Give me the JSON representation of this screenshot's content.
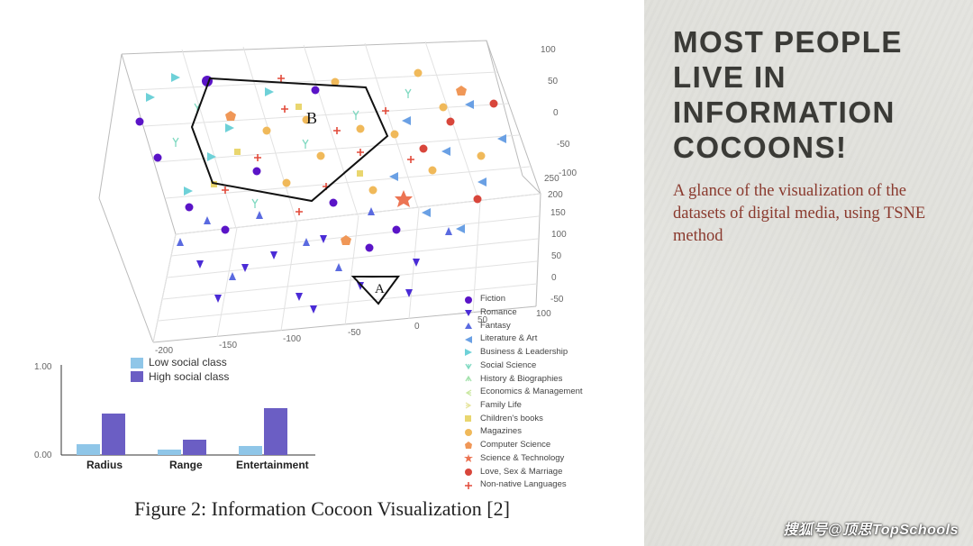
{
  "sidebar": {
    "title": "MOST PEOPLE LIVE IN INFORMATION COCOONS!",
    "subtitle": "A glance of the visualization of the datasets of digital media, using TSNE method"
  },
  "figure_caption": "Figure 2: Information Cocoon Visualization [2]",
  "watermark": "搜狐号@顶思TopSchools",
  "chart_data": [
    {
      "type": "scatter",
      "projection": "3d",
      "title": "",
      "xlabel": "",
      "ylabel": "",
      "zlabel": "",
      "xlim": [
        -200,
        200
      ],
      "ylim": [
        -100,
        100
      ],
      "zlim": [
        -100,
        100
      ],
      "xticks": [
        -200,
        -150,
        -100,
        -50,
        0,
        50,
        100
      ],
      "yticks": [
        -50,
        0,
        50,
        100,
        150,
        200,
        250
      ],
      "zticks": [
        -100,
        -50,
        0,
        50,
        100
      ],
      "annotations": [
        "A",
        "B"
      ],
      "legend": [
        {
          "label": "Fiction",
          "marker": "circle",
          "color": "#5a14c7"
        },
        {
          "label": "Romance",
          "marker": "triangle-down",
          "color": "#4a2bd6"
        },
        {
          "label": "Fantasy",
          "marker": "triangle-up",
          "color": "#5a6ae0"
        },
        {
          "label": "Literature & Art",
          "marker": "triangle-left",
          "color": "#6aa0e4"
        },
        {
          "label": "Business & Leadership",
          "marker": "triangle-right",
          "color": "#6ed1d8"
        },
        {
          "label": "Social Science",
          "marker": "tri-down",
          "color": "#7fd9c1"
        },
        {
          "label": "History & Biographies",
          "marker": "tri-up",
          "color": "#a3e2ab"
        },
        {
          "label": "Economics & Management",
          "marker": "tri-left",
          "color": "#c9e8a0"
        },
        {
          "label": "Family Life",
          "marker": "tri-right",
          "color": "#e6e49c"
        },
        {
          "label": "Children's books",
          "marker": "square",
          "color": "#e9d66f"
        },
        {
          "label": "Magazines",
          "marker": "circle",
          "color": "#f0b95a"
        },
        {
          "label": "Computer Science",
          "marker": "pentagon",
          "color": "#f09757"
        },
        {
          "label": "Science & Technology",
          "marker": "star",
          "color": "#ec7453"
        },
        {
          "label": "Love, Sex & Marriage",
          "marker": "circle",
          "color": "#d8463b"
        },
        {
          "label": "Non-native Languages",
          "marker": "plus",
          "color": "#e24a3a"
        }
      ],
      "note": "Approx. 175 points distributed roughly evenly across the 15 categories within a t-SNE cube; two polygon regions drawn and labeled A (small) and B (large).",
      "series_counts": {
        "Fiction": 12,
        "Romance": 12,
        "Fantasy": 12,
        "Literature & Art": 12,
        "Business & Leadership": 12,
        "Social Science": 12,
        "History & Biographies": 12,
        "Economics & Management": 12,
        "Family Life": 12,
        "Children's books": 11,
        "Magazines": 12,
        "Computer Science": 12,
        "Science & Technology": 12,
        "Love, Sex & Marriage": 12,
        "Non-native Languages": 12
      }
    },
    {
      "type": "bar",
      "title": "",
      "categories": [
        "Radius",
        "Range",
        "Entertainment"
      ],
      "ylim": [
        0,
        1.0
      ],
      "yticks": [
        0.0,
        1.0
      ],
      "legend": [
        "Low social class",
        "High social class"
      ],
      "colors": {
        "Low social class": "#8fc6e8",
        "High social class": "#6b5ec4"
      },
      "series": [
        {
          "name": "Low social class",
          "values": [
            0.12,
            0.06,
            0.1
          ]
        },
        {
          "name": "High social class",
          "values": [
            0.46,
            0.17,
            0.52
          ]
        }
      ]
    }
  ],
  "bar_y0": "0.00",
  "bar_y1": "1.00"
}
